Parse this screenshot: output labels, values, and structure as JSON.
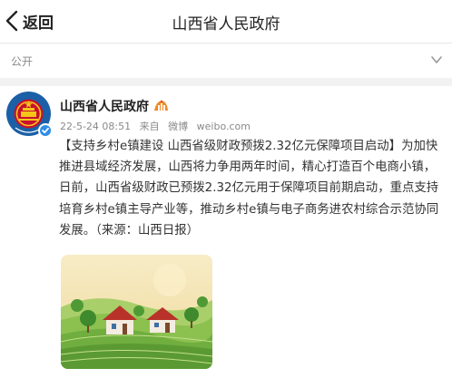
{
  "nav": {
    "back_label": "返回",
    "title": "山西省人民政府"
  },
  "visibility": {
    "label": "公开"
  },
  "post": {
    "username": "山西省人民政府",
    "timestamp": "22-5-24 08:51",
    "source_prefix": "来自",
    "source_app": "微博",
    "source_domain": "weibo.com",
    "text": "【支持乡村e镇建设 山西省级财政预拨2.32亿元保障项目启动】为加快推进县域经济发展，山西将力争用两年时间，精心打造百个电商小镇，日前，山西省级财政已预拨2.32亿元用于保障项目前期启动，重点支持培育乡村e镇主导产业等，推动乡村e镇与电子商务进农村综合示范协同发展。（来源：山西日报）"
  },
  "colors": {
    "avatar_bg": "#1b5fa6",
    "verified": "#2f8de4",
    "badge": "#f08a24",
    "sky": "#f6e7b8",
    "field_green": "#7fbf4a"
  },
  "icons": {
    "back": "chevron-left-icon",
    "visibility": "chevron-down-icon",
    "verified": "verified-check-icon",
    "badge": "gov-badge-icon"
  }
}
